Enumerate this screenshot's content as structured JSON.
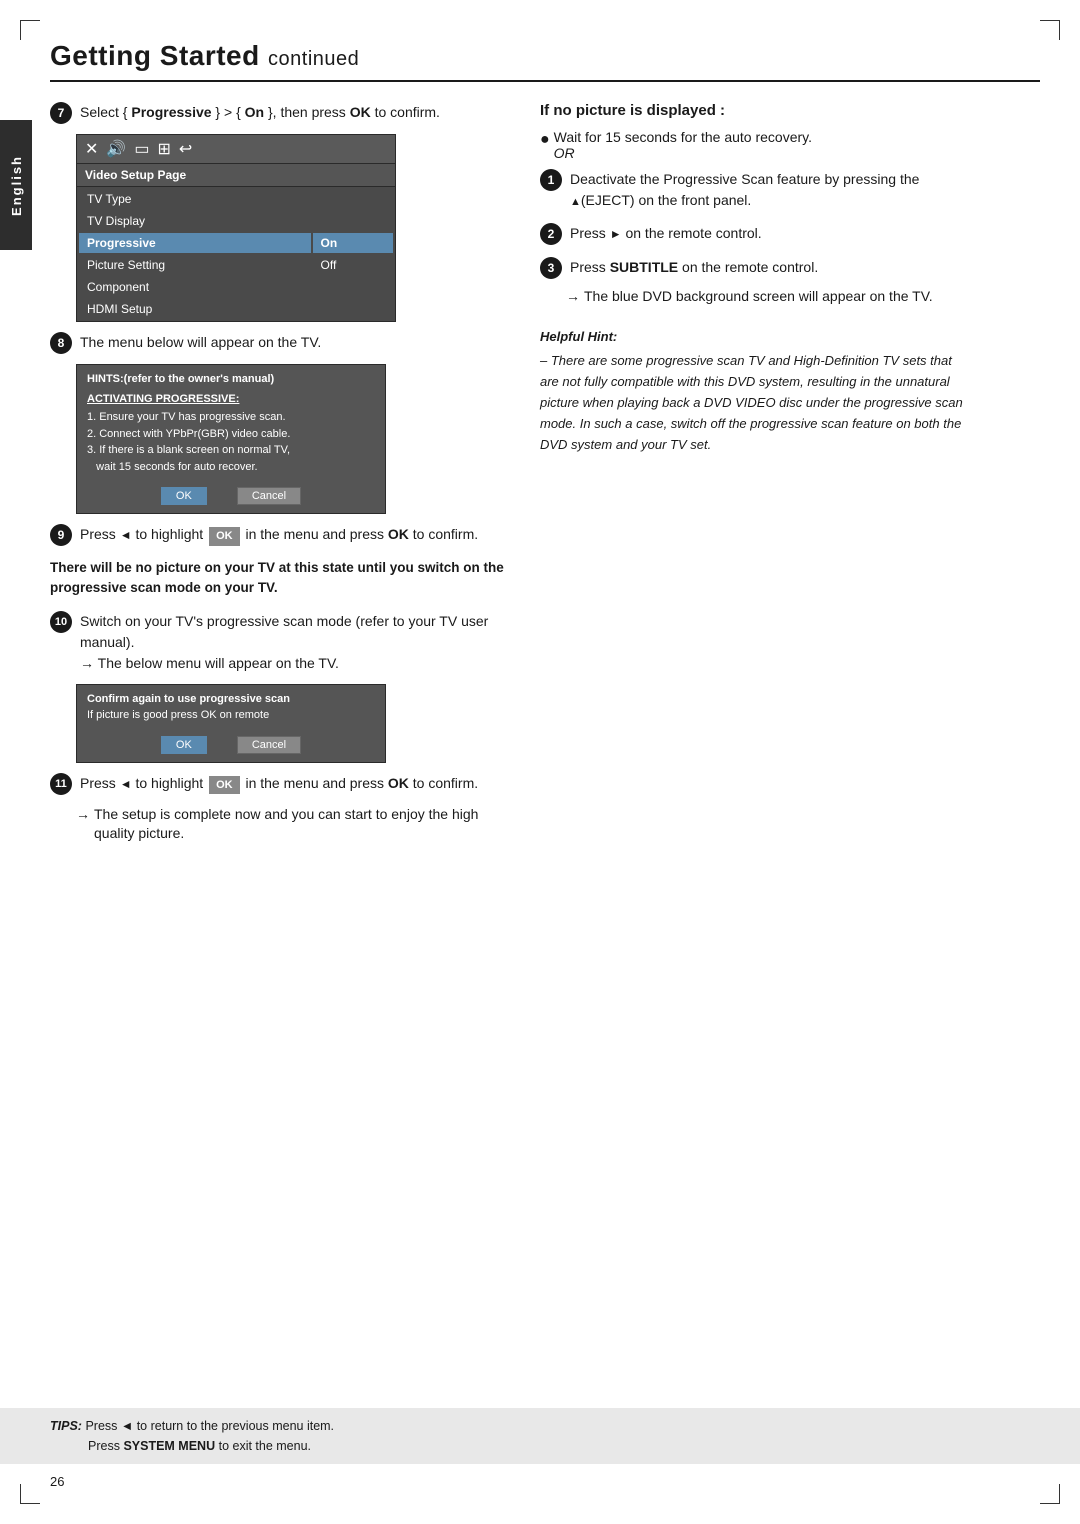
{
  "page": {
    "title": "Getting Started",
    "title_continued": "continued",
    "page_number": "26",
    "sidebar_lang": "English"
  },
  "tips_bar": {
    "tips_label": "TIPS:",
    "tip1": "Press ◄ to return to the previous menu item.",
    "tip2": "Press SYSTEM MENU to exit the menu."
  },
  "left_col": {
    "step7": {
      "text": "Select { Progressive } > { On }, then press OK to confirm."
    },
    "video_setup": {
      "header": "Video Setup Page",
      "rows": [
        {
          "label": "TV Type",
          "value": ""
        },
        {
          "label": "TV Display",
          "value": ""
        },
        {
          "label": "Progressive",
          "value": "On",
          "highlighted": true
        },
        {
          "label": "Picture Setting",
          "value": "Off"
        },
        {
          "label": "Component",
          "value": ""
        },
        {
          "label": "HDMI Setup",
          "value": ""
        }
      ]
    },
    "step8": "The menu below will appear on the TV.",
    "dialog1": {
      "title": "HINTS:(refer to the owner's manual)",
      "activating": "ACTIVATING PROGRESSIVE:",
      "lines": [
        "1. Ensure your TV has progressive scan.",
        "2. Connect with YPbPr(GBR) video cable.",
        "3. If there is a blank screen on normal TV,",
        "    wait 15 seconds for auto recover."
      ],
      "btn_ok": "OK",
      "btn_cancel": "Cancel"
    },
    "step9": {
      "pre": "Press ◄ to highlight",
      "ok_badge": "OK",
      "post": "in the menu and press OK to confirm."
    },
    "warning": "There will be no picture on your TV at this state until you switch on the progressive scan mode on your TV.",
    "step10": {
      "text": "Switch on your TV's progressive scan mode (refer to your TV user manual).",
      "arrow": "The below menu will appear on the TV."
    },
    "dialog2": {
      "line1": "Confirm again to use progressive scan",
      "line2": "If picture is good press OK on remote",
      "btn_ok": "OK",
      "btn_cancel": "Cancel"
    },
    "step11": {
      "pre": "Press ◄ to highlight",
      "ok_badge": "OK",
      "post": "in the menu and press OK to confirm.",
      "arrow": "The setup is complete now and you can start to enjoy the high quality picture."
    }
  },
  "right_col": {
    "heading": "If no picture is displayed :",
    "bullet1": "Wait for 15 seconds for the auto recovery.",
    "bullet1_or": "OR",
    "step1": "Deactivate the Progressive Scan feature by pressing the ▲(EJECT) on the front panel.",
    "step2": "Press ► on the remote control.",
    "step3_pre": "Press",
    "step3_bold": "SUBTITLE",
    "step3_post": "on the remote control.",
    "arrow1": "The blue DVD background screen will appear on the TV.",
    "hint_title": "Helpful Hint:",
    "hint_body": "– There are some progressive scan TV and High-Definition TV sets that are not fully compatible with this DVD system, resulting in the unnatural picture when playing back a DVD VIDEO disc under the progressive scan mode. In such a case, switch off the progressive scan feature on both the DVD system and your TV set."
  }
}
